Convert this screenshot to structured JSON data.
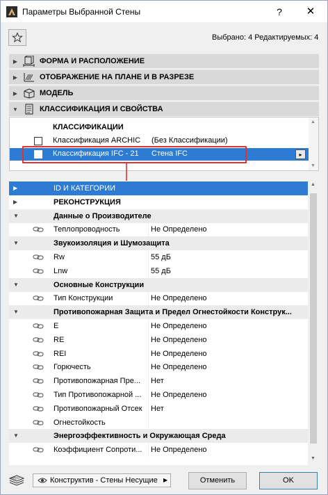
{
  "window": {
    "title": "Параметры Выбранной Стены",
    "help_label": "?",
    "close_label": "✕"
  },
  "toolbar": {
    "favorites_icon": "star-icon",
    "selection_info": "Выбрано: 4 Редактируемых: 4"
  },
  "panels": [
    {
      "label": "ФОРМА И РАСПОЛОЖЕНИЕ",
      "icon": "geometry-icon",
      "expanded": false
    },
    {
      "label": "ОТОБРАЖЕНИЕ НА ПЛАНЕ И В РАЗРЕЗЕ",
      "icon": "plan-section-icon",
      "expanded": false
    },
    {
      "label": "МОДЕЛЬ",
      "icon": "model-icon",
      "expanded": false
    },
    {
      "label": "КЛАССИФИКАЦИЯ И СВОЙСТВА",
      "icon": "classification-icon",
      "expanded": true
    }
  ],
  "classifications": {
    "header": "КЛАССИФИКАЦИИ",
    "rows": [
      {
        "name": "Классификация ARCHIC",
        "value": "(Без Классификации)",
        "checked": false,
        "selected": false
      },
      {
        "name": "Классификация IFC - 21",
        "value": "Стена IFC",
        "checked": true,
        "selected": true
      }
    ],
    "row_button": "▸"
  },
  "properties": {
    "rows": [
      {
        "type": "id",
        "name": "ID И КАТЕГОРИИ",
        "value": ""
      },
      {
        "type": "topgroup",
        "name": "РЕКОНСТРУКЦИЯ",
        "value": ""
      },
      {
        "type": "group",
        "name": "Данные о Производителе",
        "value": ""
      },
      {
        "type": "item",
        "name": "Теплопроводность",
        "value": "Не Определено"
      },
      {
        "type": "group",
        "name": "Звукоизоляция и Шумозащита",
        "value": ""
      },
      {
        "type": "item",
        "name": "Rw",
        "value": "55 дБ"
      },
      {
        "type": "item",
        "name": "Lnw",
        "value": "55 дБ"
      },
      {
        "type": "group",
        "name": "Основные Конструкции",
        "value": ""
      },
      {
        "type": "item",
        "name": "Тип Конструкции",
        "value": "Не Определено"
      },
      {
        "type": "group",
        "name": "Противопожарная Защита и Предел Огнестойкости Конструк...",
        "value": ""
      },
      {
        "type": "item",
        "name": "E",
        "value": "Не Определено"
      },
      {
        "type": "item",
        "name": "RE",
        "value": "Не Определено"
      },
      {
        "type": "item",
        "name": "REI",
        "value": "Не Определено"
      },
      {
        "type": "item",
        "name": "Горючесть",
        "value": "Не Определено"
      },
      {
        "type": "item",
        "name": "Противопожарная Пре...",
        "value": "Нет"
      },
      {
        "type": "item",
        "name": "Тип Противопожарной ...",
        "value": "Не Определено"
      },
      {
        "type": "item",
        "name": "Противопожарный Отсек",
        "value": "Нет"
      },
      {
        "type": "item",
        "name": "Огнестойкость",
        "value": ""
      },
      {
        "type": "group",
        "name": "Энергоэффективность и Окружающая Среда",
        "value": ""
      },
      {
        "type": "item",
        "name": "Коэффициент Сопроти...",
        "value": "Не Определено"
      }
    ]
  },
  "footer": {
    "layer_label": "Конструктив - Стены Несущие",
    "cancel_label": "Отменить",
    "ok_label": "OK"
  },
  "colors": {
    "selection": "#2e7bd4",
    "highlight_frame": "#e53030"
  }
}
